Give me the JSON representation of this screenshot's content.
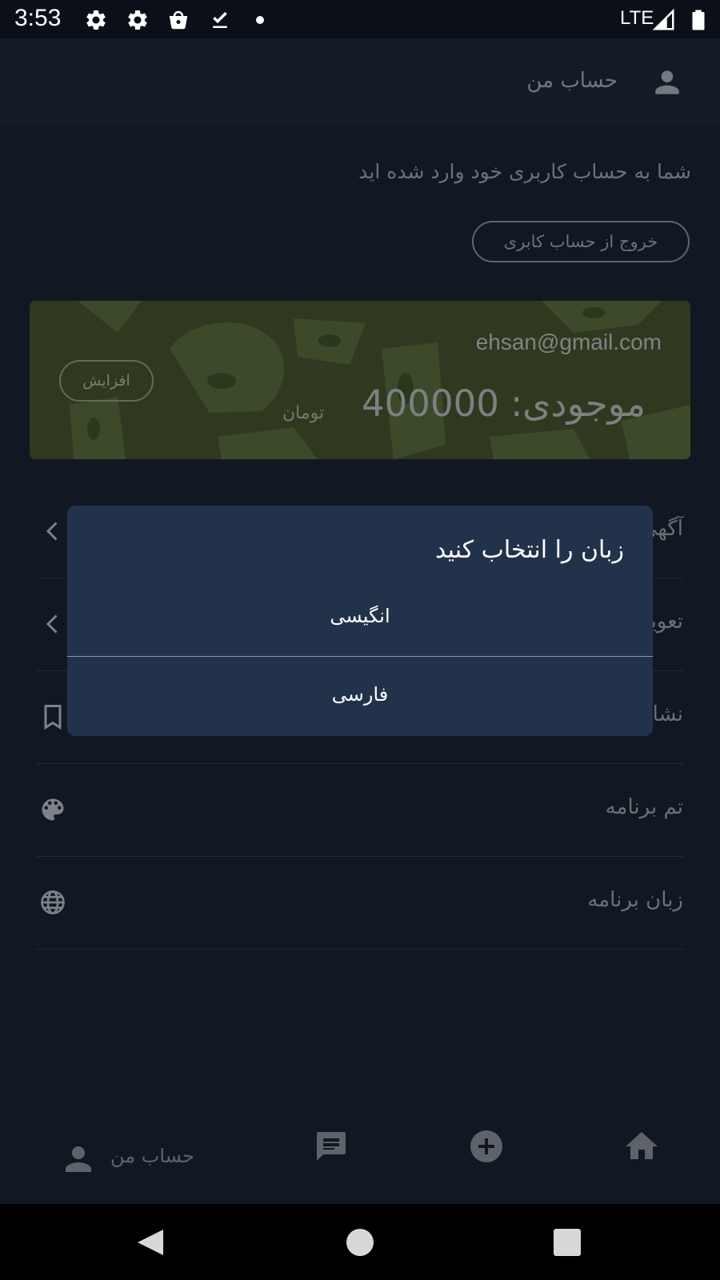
{
  "status_bar": {
    "time": "3:53",
    "network": "LTE",
    "icons": [
      "settings-icon",
      "settings-icon",
      "shopping-bag-icon",
      "download-done-icon",
      "dot-icon",
      "signal-icon",
      "battery-icon"
    ]
  },
  "app_bar": {
    "title": "حساب من",
    "icon": "account-icon"
  },
  "account": {
    "logged_in_text": "شما به حساب کاربری خود وارد شده اید",
    "logout_label": "خروج از حساب کابری"
  },
  "wallet": {
    "email": "ehsan@gmail.com",
    "balance": "موجودی: 400000",
    "currency": "تومان",
    "increase_label": "افزایش"
  },
  "menu": {
    "items": [
      {
        "label": "آگهی های من",
        "icon": "chevron-left-icon"
      },
      {
        "label": "تعویض رمز عبور",
        "icon": "chevron-left-icon"
      },
      {
        "label": "نشان شده ها",
        "icon": "bookmark-icon"
      },
      {
        "label": "تم برنامه",
        "icon": "palette-icon"
      },
      {
        "label": "زبان برنامه",
        "icon": "globe-icon"
      }
    ]
  },
  "dialog": {
    "title": "زبان را انتخاب کنید",
    "options": [
      "انگیسی",
      "فارسی"
    ]
  },
  "bottom_nav": {
    "items": [
      {
        "label": "حساب من",
        "icon": "account-icon"
      },
      {
        "label": "",
        "icon": "chat-icon"
      },
      {
        "label": "",
        "icon": "add-circle-icon"
      },
      {
        "label": "",
        "icon": "home-icon"
      }
    ]
  },
  "system_nav": {
    "icons": [
      "back-icon",
      "home-circle-icon",
      "recents-icon"
    ]
  },
  "colors": {
    "background": "#111822",
    "dialog_bg": "#23324b",
    "card_bg": "#30391f",
    "text_muted": "#6d7178"
  }
}
